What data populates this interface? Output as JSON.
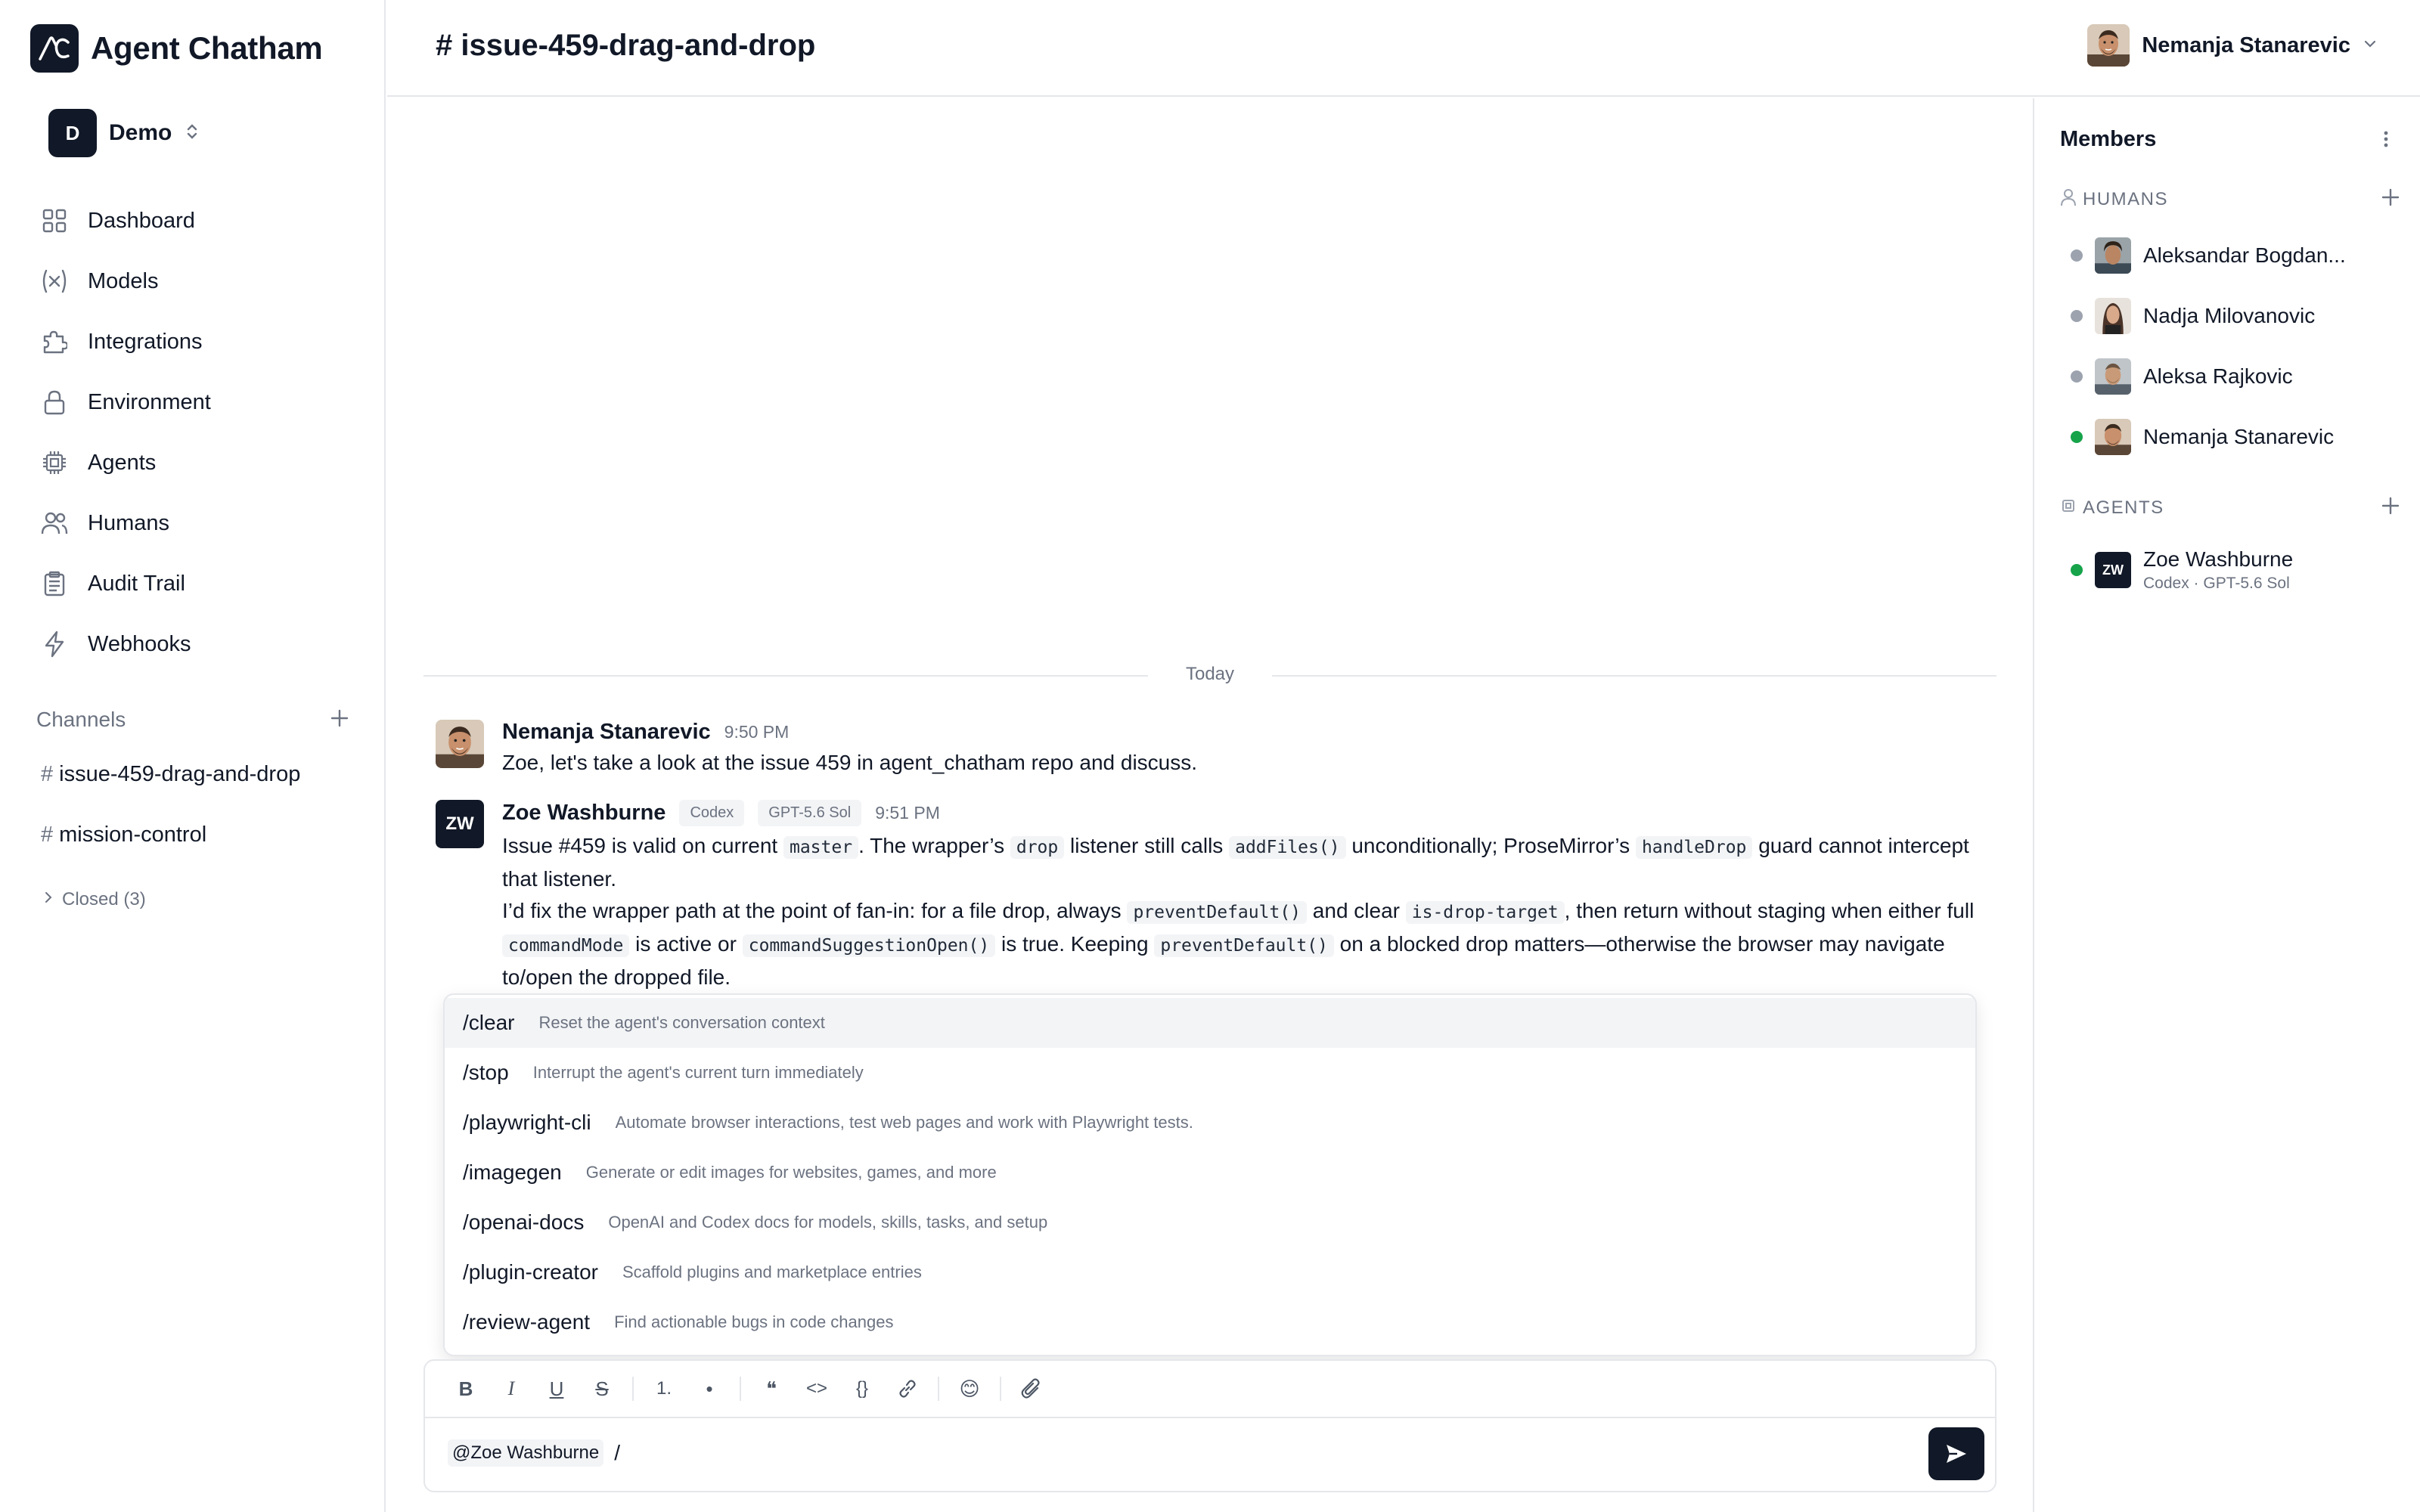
{
  "app": {
    "name": "Agent Chatham"
  },
  "workspace": {
    "initial": "D",
    "name": "Demo"
  },
  "nav": [
    {
      "label": "Dashboard",
      "icon": "dashboard-icon"
    },
    {
      "label": "Models",
      "icon": "variable-icon"
    },
    {
      "label": "Integrations",
      "icon": "puzzle-icon"
    },
    {
      "label": "Environment",
      "icon": "lock-icon"
    },
    {
      "label": "Agents",
      "icon": "chip-icon"
    },
    {
      "label": "Humans",
      "icon": "users-icon"
    },
    {
      "label": "Audit Trail",
      "icon": "clipboard-icon"
    },
    {
      "label": "Webhooks",
      "icon": "bolt-icon"
    }
  ],
  "channels": {
    "title": "Channels",
    "items": [
      {
        "name": "issue-459-drag-and-drop"
      },
      {
        "name": "mission-control"
      }
    ],
    "closed_label": "Closed (3)"
  },
  "header": {
    "channel_title": "# issue-459-drag-and-drop",
    "current_user": "Nemanja Stanarevic"
  },
  "conversation": {
    "divider": "Today",
    "messages": [
      {
        "author": "Nemanja Stanarevic",
        "time": "9:50 PM",
        "text": "Zoe, let's take a look at the issue 459 in agent_chatham repo and discuss."
      },
      {
        "author": "Zoe Washburne",
        "avatar_initials": "ZW",
        "tags": [
          "Codex",
          "GPT-5.6 Sol"
        ],
        "time": "9:51 PM",
        "p1": {
          "t1": "Issue #459 is valid on current ",
          "c1": "master",
          "t2": ". The wrapper’s ",
          "c2": "drop",
          "t3": " listener still calls ",
          "c3": "addFiles()",
          "t4": " unconditionally; ProseMirror’s ",
          "c4": "handleDrop",
          "t5": " guard cannot intercept that listener."
        },
        "p2": {
          "t1": "I’d fix the wrapper path at the point of fan-in: for a file drop, always ",
          "c1": "preventDefault()",
          "t2": " and clear ",
          "c2": "is-drop-target",
          "t3": ", then return without staging when either full ",
          "c3": "commandMode",
          "t4": " is active or ",
          "c4": "commandSuggestionOpen()",
          "t5": " is true. Keeping ",
          "c5": "preventDefault()",
          "t6": " on a blocked drop matters—otherwise the browser may navigate to/open the dropped file."
        }
      }
    ]
  },
  "commands": [
    {
      "command": "/clear",
      "description": "Reset the agent's conversation context"
    },
    {
      "command": "/stop",
      "description": "Interrupt the agent's current turn immediately"
    },
    {
      "command": "/playwright-cli",
      "description": "Automate browser interactions, test web pages and work with Playwright tests."
    },
    {
      "command": "/imagegen",
      "description": "Generate or edit images for websites, games, and more"
    },
    {
      "command": "/openai-docs",
      "description": "OpenAI and Codex docs for models, skills, tasks, and setup"
    },
    {
      "command": "/plugin-creator",
      "description": "Scaffold plugins and marketplace entries"
    },
    {
      "command": "/review-agent",
      "description": "Find actionable bugs in code changes"
    }
  ],
  "composer": {
    "toolbar": {
      "bold": "B",
      "italic": "I",
      "underline": "U",
      "strike": "S",
      "ordered": "1.",
      "bullet": "•",
      "quote": "❝",
      "code": "<>",
      "codeblock": "{}",
      "emoji": "😊"
    },
    "mention": "@Zoe Washburne",
    "typed": "/"
  },
  "members": {
    "title": "Members",
    "humans_label": "HUMANS",
    "humans": [
      {
        "name": "Aleksandar Bogdan...",
        "online": false
      },
      {
        "name": "Nadja Milovanovic",
        "online": false
      },
      {
        "name": "Aleksa Rajkovic",
        "online": false
      },
      {
        "name": "Nemanja Stanarevic",
        "online": true
      }
    ],
    "agents_label": "AGENTS",
    "agents": [
      {
        "name": "Zoe Washburne",
        "initials": "ZW",
        "sub": "Codex · GPT-5.6 Sol",
        "online": true
      }
    ]
  },
  "colors": {
    "accent": "#111827",
    "online": "#16a34a",
    "offline": "#9ca3af",
    "muted": "#6b7280"
  }
}
